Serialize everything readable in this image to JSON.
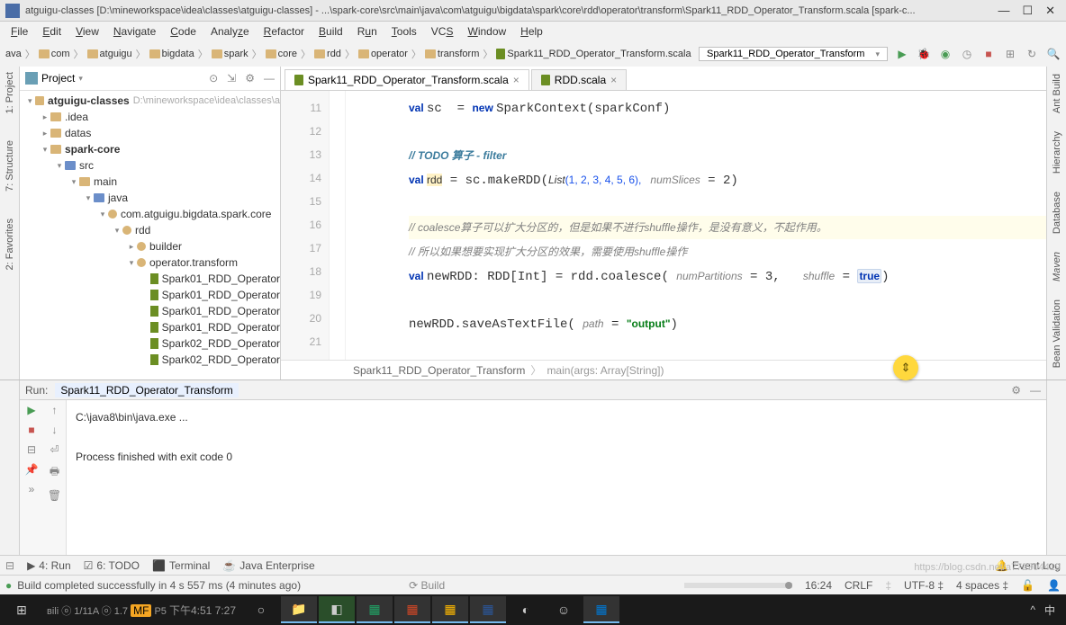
{
  "titlebar": {
    "text": "atguigu-classes [D:\\mineworkspace\\idea\\classes\\atguigu-classes] - ...\\spark-core\\src\\main\\java\\com\\atguigu\\bigdata\\spark\\core\\rdd\\operator\\transform\\Spark11_RDD_Operator_Transform.scala [spark-c..."
  },
  "menu": [
    "File",
    "Edit",
    "View",
    "Navigate",
    "Code",
    "Analyze",
    "Refactor",
    "Build",
    "Run",
    "Tools",
    "VCS",
    "Window",
    "Help"
  ],
  "navcrumbs": [
    "ava",
    "com",
    "atguigu",
    "bigdata",
    "spark",
    "core",
    "rdd",
    "operator",
    "transform",
    "Spark11_RDD_Operator_Transform.scala"
  ],
  "runconfig": "Spark11_RDD_Operator_Transform",
  "leftTools": [
    "1: Project",
    "7: Structure",
    "2: Favorites"
  ],
  "rightTools": [
    "Ant Build",
    "Hierarchy",
    "Database",
    "Maven",
    "Bean Validation"
  ],
  "project": {
    "header": "Project",
    "root": {
      "label": "atguigu-classes",
      "suffix": "D:\\mineworkspace\\idea\\classes\\a"
    },
    "items": [
      {
        "indent": 1,
        "tw": "▸",
        "icon": "folder",
        "label": ".idea"
      },
      {
        "indent": 1,
        "tw": "▸",
        "icon": "folder",
        "label": "datas"
      },
      {
        "indent": 1,
        "tw": "▾",
        "icon": "folder",
        "label": "spark-core",
        "bold": true
      },
      {
        "indent": 2,
        "tw": "▾",
        "icon": "bluesrc",
        "label": "src"
      },
      {
        "indent": 3,
        "tw": "▾",
        "icon": "folder",
        "label": "main"
      },
      {
        "indent": 4,
        "tw": "▾",
        "icon": "bluesrc",
        "label": "java"
      },
      {
        "indent": 5,
        "tw": "▾",
        "icon": "pkg",
        "label": "com.atguigu.bigdata.spark.core"
      },
      {
        "indent": 6,
        "tw": "▾",
        "icon": "pkg",
        "label": "rdd"
      },
      {
        "indent": 7,
        "tw": "▸",
        "icon": "pkg",
        "label": "builder"
      },
      {
        "indent": 7,
        "tw": "▾",
        "icon": "pkg",
        "label": "operator.transform"
      },
      {
        "indent": 8,
        "tw": "",
        "icon": "scala",
        "label": "Spark01_RDD_Operator"
      },
      {
        "indent": 8,
        "tw": "",
        "icon": "scala",
        "label": "Spark01_RDD_Operator"
      },
      {
        "indent": 8,
        "tw": "",
        "icon": "scala",
        "label": "Spark01_RDD_Operator"
      },
      {
        "indent": 8,
        "tw": "",
        "icon": "scala",
        "label": "Spark01_RDD_Operator"
      },
      {
        "indent": 8,
        "tw": "",
        "icon": "scala",
        "label": "Spark02_RDD_Operator"
      },
      {
        "indent": 8,
        "tw": "",
        "icon": "scala",
        "label": "Spark02_RDD_Operator"
      }
    ]
  },
  "tabs": [
    {
      "label": "Spark11_RDD_Operator_Transform.scala",
      "active": true
    },
    {
      "label": "RDD.scala",
      "active": false
    }
  ],
  "gutter_lines": [
    "11",
    "12",
    "13",
    "14",
    "15",
    "16",
    "17",
    "18",
    "19",
    "20",
    "21"
  ],
  "code": {
    "l11": {
      "pre": "val ",
      "var": "sc",
      "mid": " = ",
      "new": "new ",
      "rest": "SparkContext(sparkConf)"
    },
    "l13": "// TODO 算子 - filter",
    "l14": {
      "pre": "val ",
      "var": "rdd",
      "mid": " = sc.makeRDD(",
      "list": "List",
      "args": "(1, 2, 3, 4, 5, 6),   ",
      "pname": "numSlices",
      "pval": " = 2)"
    },
    "l16": "// coalesce算子可以扩大分区的，但是如果不进行shuffle操作，是没有意义，不起作用。",
    "l17": "// 所以如果想要实现扩大分区的效果，需要使用shuffle操作",
    "l18": {
      "pre": "val ",
      "var": "newRDD",
      "mid": ": RDD[Int] = rdd.coalesce( ",
      "p1": "numPartitions",
      "v1": " = 3,   ",
      "p2": "shuffle",
      "v2": " = ",
      "bool": "true",
      ")": ")"
    },
    "l20": {
      "call": "newRDD.saveAsTextFile( ",
      "p": "path",
      "eq": " = ",
      "str": "\"output\"",
      ")": ")"
    }
  },
  "bottom_crumb": {
    "a": "Spark11_RDD_Operator_Transform",
    "b": "main(args: Array[String])"
  },
  "run": {
    "header_label": "Run:",
    "header_config": "Spark11_RDD_Operator_Transform",
    "out_line1": "C:\\java8\\bin\\java.exe ...",
    "out_line2": "Process finished with exit code 0"
  },
  "bottom_tools": {
    "run": "4: Run",
    "todo": "6: TODO",
    "terminal": "Terminal",
    "javaee": "Java Enterprise",
    "eventlog": "Event Log"
  },
  "statusbar": {
    "msg": "Build completed successfully in 4 s 557 ms (4 minutes ago)",
    "build": "Build",
    "time": "16:24",
    "crlf": "CRLF",
    "enc": "UTF-8",
    "indent": "4 spaces"
  },
  "watermark": "https://blog.csdn.net/a772304419",
  "taskbar": {
    "time": "下午4:51 7:27"
  }
}
